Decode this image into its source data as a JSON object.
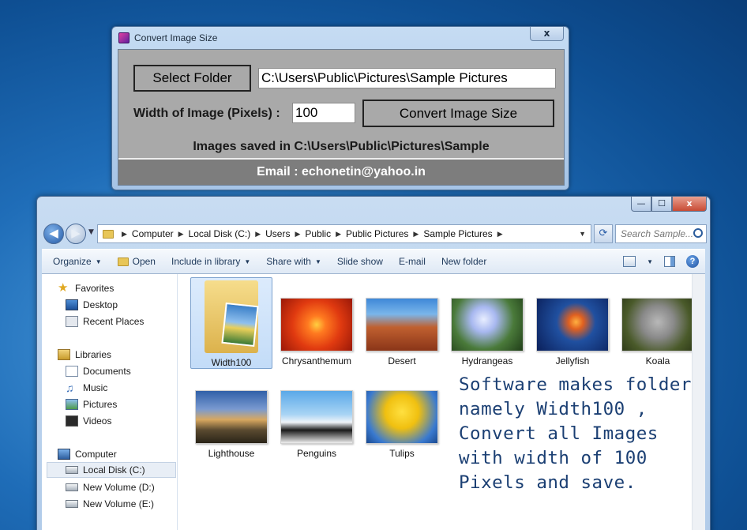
{
  "dialog": {
    "title": "Convert Image Size",
    "close_label": "x",
    "select_folder_label": "Select Folder",
    "folder_path": "C:\\Users\\Public\\Pictures\\Sample Pictures",
    "width_label": "Width of Image (Pixels) :",
    "width_value": "100",
    "convert_label": "Convert Image Size",
    "status_text": "Images saved in C:\\Users\\Public\\Pictures\\Sample",
    "email_text": "Email : echonetin@yahoo.in"
  },
  "explorer": {
    "caption_buttons": {
      "minimize": "—",
      "maximize": "☐",
      "close": "x"
    },
    "breadcrumb": [
      "Computer",
      "Local Disk (C:)",
      "Users",
      "Public",
      "Public Pictures",
      "Sample Pictures"
    ],
    "search_placeholder": "Search Sample...",
    "toolbar": {
      "organize": "Organize",
      "open": "Open",
      "include_in_library": "Include in library",
      "share_with": "Share with",
      "slide_show": "Slide show",
      "email": "E-mail",
      "new_folder": "New folder",
      "help": "?"
    },
    "nav": {
      "favorites": "Favorites",
      "desktop": "Desktop",
      "recent_places": "Recent Places",
      "libraries": "Libraries",
      "documents": "Documents",
      "music": "Music",
      "pictures": "Pictures",
      "videos": "Videos",
      "computer": "Computer",
      "local_disk": "Local Disk (C:)",
      "new_volume_d": "New Volume (D:)",
      "new_volume_e": "New Volume (E:)"
    },
    "files": [
      "Width100",
      "Chrysanthemum",
      "Desert",
      "Hydrangeas",
      "Jellyfish",
      "Koala",
      "Lighthouse",
      "Penguins",
      "Tulips"
    ],
    "note": "Software makes folder namely Width100 , Convert all Images with width of 100 Pixels and save."
  }
}
